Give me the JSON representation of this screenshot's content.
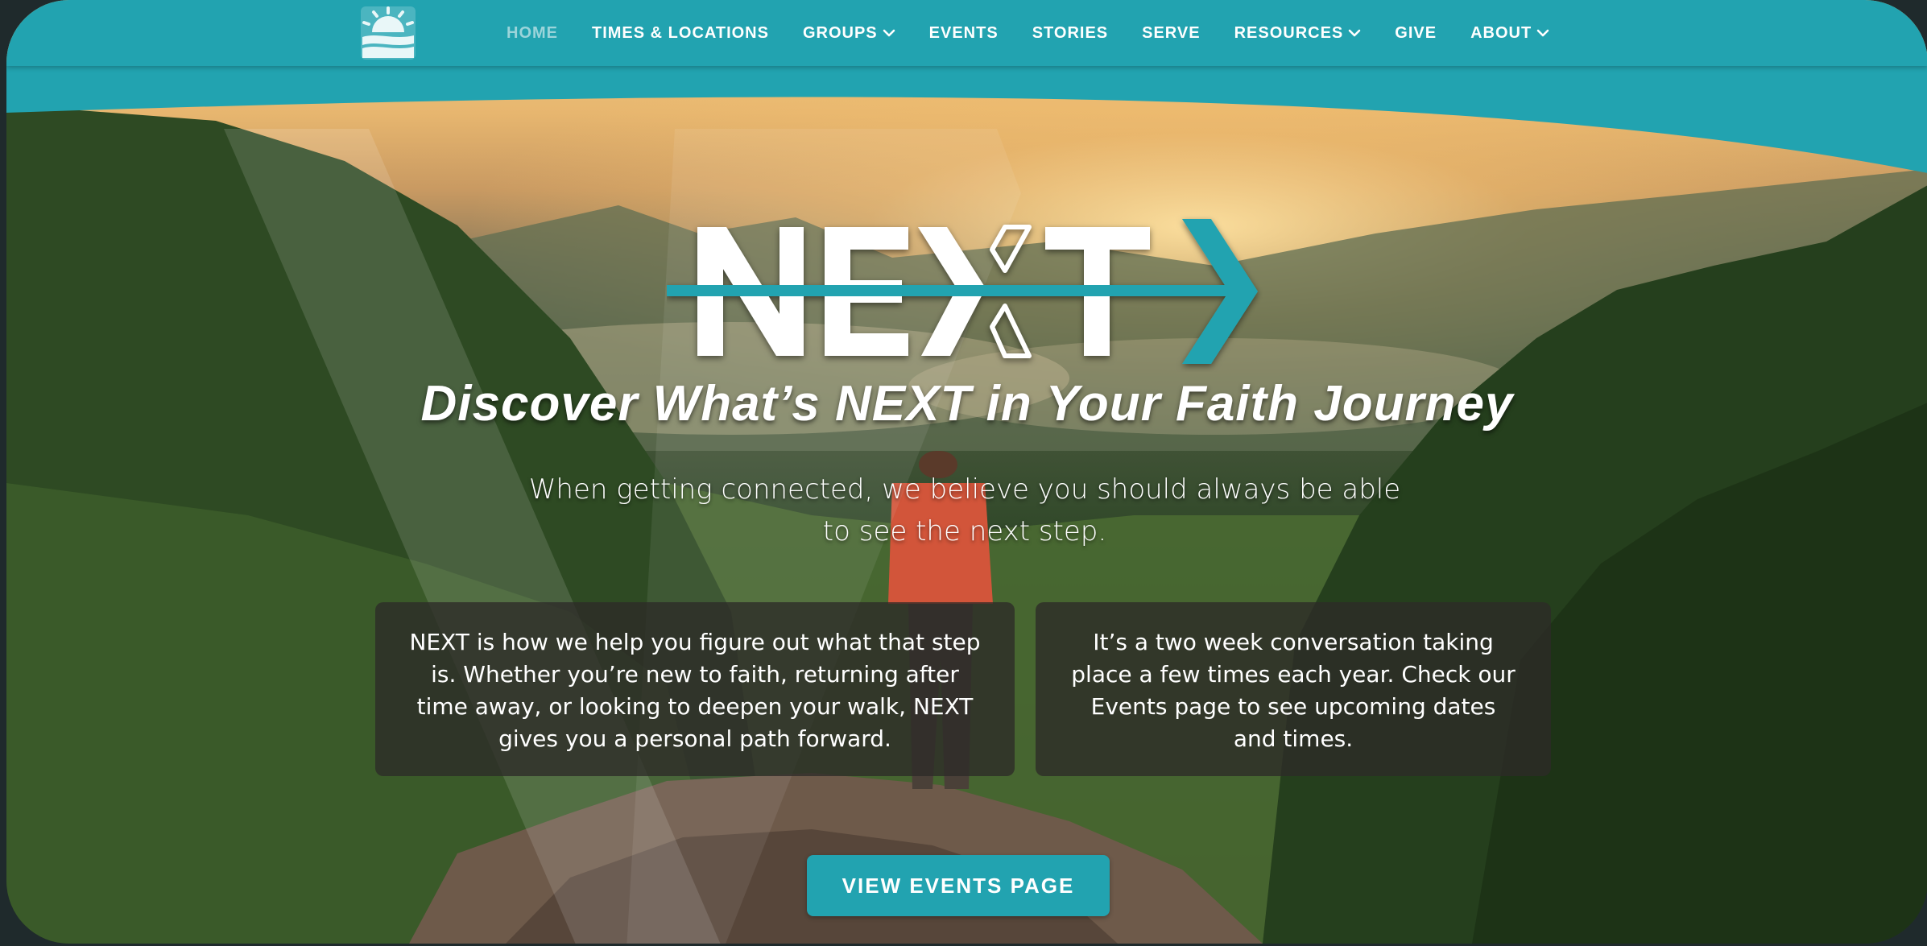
{
  "nav": {
    "items": [
      {
        "label": "HOME",
        "active": true,
        "dropdown": false
      },
      {
        "label": "TIMES & LOCATIONS",
        "active": false,
        "dropdown": false
      },
      {
        "label": "GROUPS",
        "active": false,
        "dropdown": true
      },
      {
        "label": "EVENTS",
        "active": false,
        "dropdown": false
      },
      {
        "label": "STORIES",
        "active": false,
        "dropdown": false
      },
      {
        "label": "SERVE",
        "active": false,
        "dropdown": false
      },
      {
        "label": "RESOURCES",
        "active": false,
        "dropdown": true
      },
      {
        "label": "GIVE",
        "active": false,
        "dropdown": false
      },
      {
        "label": "ABOUT",
        "active": false,
        "dropdown": true
      }
    ]
  },
  "hero": {
    "logo_text": "NEXT",
    "tagline": "Discover What’s NEXT in Your Faith Journey",
    "intro": "When getting connected, we believe you should always be able to see the next step.",
    "card_left": "NEXT is how we help you figure out what that step is. Whether you’re new to faith, returning after time away, or looking to deepen your walk, NEXT gives you a personal path forward.",
    "card_right": "It’s a two week conversation taking place a few times each year. Check our Events page to see upcoming dates and times.",
    "cta_label": "VIEW EVENTS PAGE"
  },
  "icons": {
    "site_logo": "sunrise-hills-logo-icon",
    "dropdown": "chevron-down-icon"
  },
  "colors": {
    "brand_teal": "#22a3b0",
    "nav_active": "#9bd4da",
    "card_bg": "#2d2a28"
  }
}
